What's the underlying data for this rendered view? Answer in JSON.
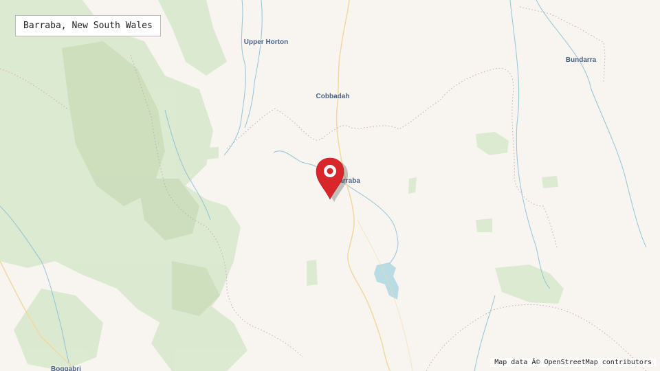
{
  "title": "Barraba, New South Wales",
  "attribution": "Map data Â© OpenStreetMap contributors",
  "places": {
    "upper_horton": "Upper Horton",
    "cobbadah": "Cobbadah",
    "bundarra": "Bundarra",
    "barraba": "Barraba",
    "boggabri": "Boggabri"
  },
  "marker": {
    "icon": "map-pin-icon",
    "color": "#d9262b"
  },
  "colors": {
    "land": "#f8f5f1",
    "forest": "#d8e7cc",
    "water": "#b8dbe4",
    "river": "#8fc3d6",
    "road": "#f2d9a4",
    "boundary": "#c9a8b0",
    "label": "#4a6285"
  }
}
